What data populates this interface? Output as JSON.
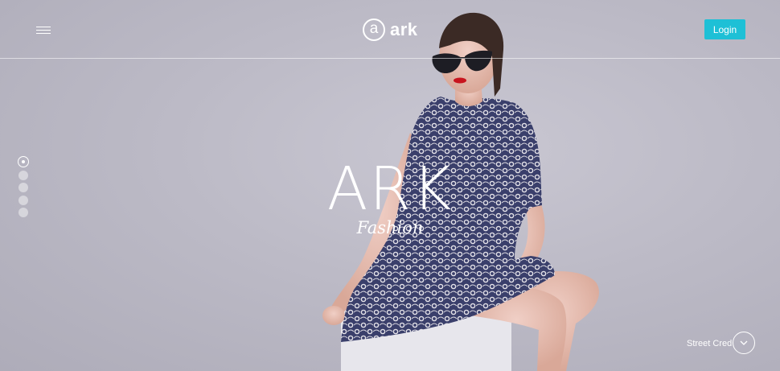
{
  "header": {
    "logo_letter": "a",
    "logo_text": "ark",
    "login_label": "Login"
  },
  "hero": {
    "title": "ARK",
    "subtitle": "Fashion",
    "slides": 5,
    "active_slide": 1
  },
  "footer": {
    "scroll_label": "Street Cred"
  },
  "colors": {
    "accent": "#1ec0d6",
    "background": "#bcbac6",
    "text": "#ffffff"
  },
  "icons": {
    "menu": "hamburger-icon",
    "scroll": "chevron-down-icon"
  }
}
